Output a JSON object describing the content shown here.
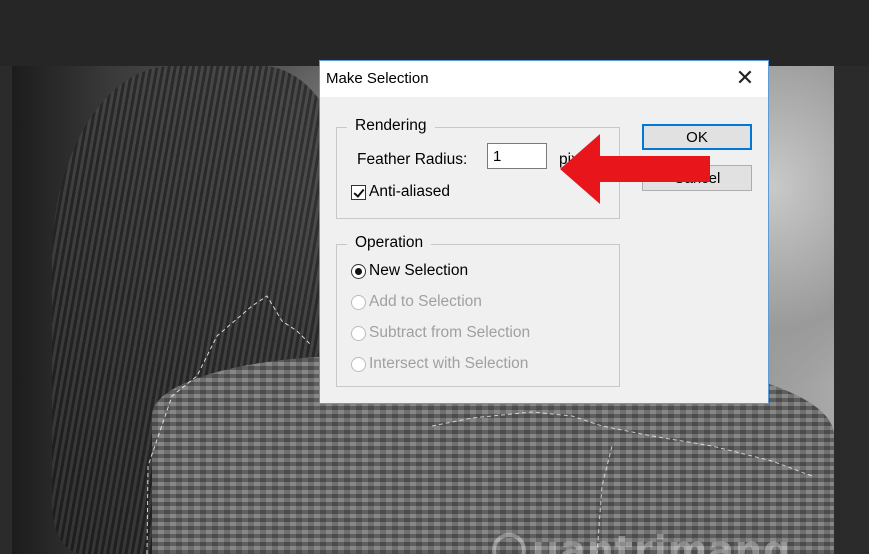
{
  "dialog": {
    "title": "Make Selection",
    "close_glyph": "✕",
    "rendering": {
      "legend": "Rendering",
      "feather_label": "Feather Radius:",
      "feather_value": "1",
      "feather_unit": "pixels",
      "anti_aliased_label": "Anti-aliased",
      "anti_aliased_checked": true
    },
    "operation": {
      "legend": "Operation",
      "options": [
        {
          "label": "New Selection",
          "selected": true,
          "enabled": true
        },
        {
          "label": "Add to Selection",
          "selected": false,
          "enabled": false
        },
        {
          "label": "Subtract from Selection",
          "selected": false,
          "enabled": false
        },
        {
          "label": "Intersect with Selection",
          "selected": false,
          "enabled": false
        }
      ]
    },
    "ok_label": "OK",
    "cancel_label": "Cancel"
  },
  "annotation": {
    "arrow_color": "#e8151b"
  },
  "watermark": {
    "text": "uantrimang"
  },
  "colors": {
    "dialog_border": "#5a9bd8",
    "ok_border": "#0078d7",
    "canvas_bg": "#2b2b2b"
  }
}
